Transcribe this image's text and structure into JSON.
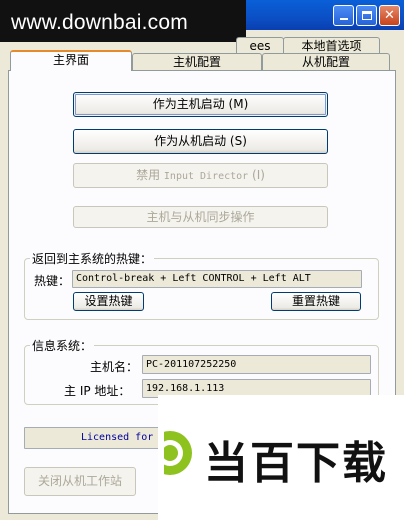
{
  "watermark": {
    "url": "www.downbai.com",
    "brand": "当百下载"
  },
  "tabs": {
    "row_back": [
      {
        "label": "ees"
      },
      {
        "label": "本地首选项"
      }
    ],
    "row_front": [
      {
        "label": "主界面"
      },
      {
        "label": "主机配置"
      },
      {
        "label": "从机配置"
      }
    ]
  },
  "buttons": {
    "start_master": "作为主机启动 (M)",
    "start_slave": "作为从机启动 (S)",
    "disable_prefix": "禁用 ",
    "disable_mono": "Input Director",
    "disable_suffix": " (I)",
    "sync": "主机与从机同步操作",
    "set_hotkey": "设置热键",
    "reset_hotkey": "重置热键",
    "close_slave": "关闭从机工作站"
  },
  "hotkey_group": {
    "title": "返回到主系统的热键：",
    "label": "热键：",
    "value": "Control-break + Left CONTROL + Left ALT"
  },
  "info_group": {
    "title": "信息系统：",
    "host_label": "主机名：",
    "host_value": "PC-201107252250",
    "ip_label": "主 IP 地址：",
    "ip_value": "192.168.1.113"
  },
  "license_text": "Licensed for"
}
